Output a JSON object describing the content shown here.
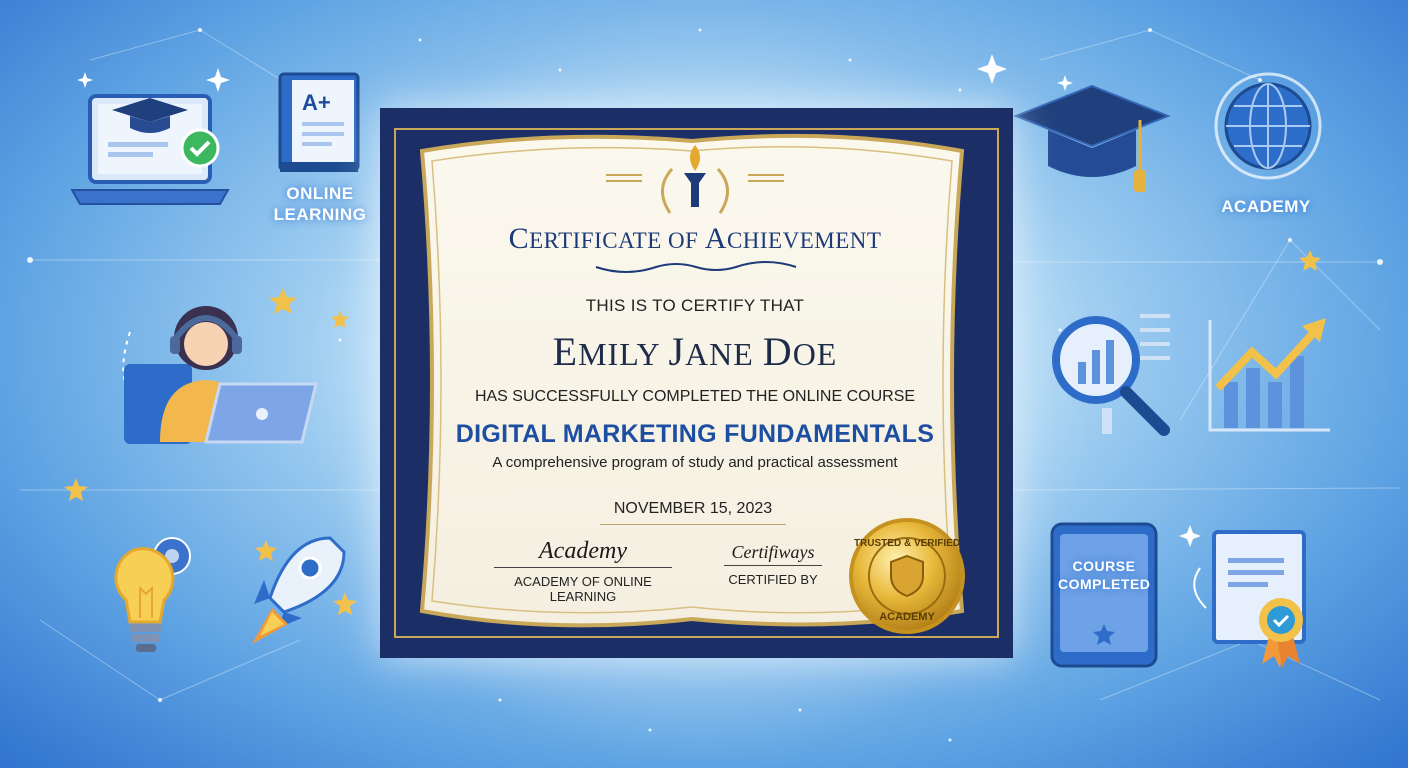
{
  "left_panel": {
    "online_learning_label": "ONLINE\nLEARNING",
    "book_grade": "A+"
  },
  "right_panel": {
    "academy_label": "ACADEMY",
    "tablet_label": "COURSE\nCOMPLETED"
  },
  "certificate": {
    "title_big_c": "C",
    "title_part1": "ERTIFICATE ",
    "title_of": "OF",
    "title_big_a": " A",
    "title_part2": "CHIEVEMENT",
    "certify_line": "THIS IS TO CERTIFY THAT",
    "recipient_e": "E",
    "recipient_rest1": "MILY ",
    "recipient_j": "J",
    "recipient_rest2": "ANE ",
    "recipient_d": "D",
    "recipient_rest3": "OE",
    "completed_line": "HAS SUCCESSFULLY COMPLETED THE ONLINE COURSE",
    "course_name": "DIGITAL MARKETING FUNDAMENTALS",
    "description": "A comprehensive program of study and practical assessment",
    "date": "NOVEMBER 15, 2023",
    "signature1_script": "Academy",
    "signature1_label": "ACADEMY OF ONLINE LEARNING",
    "signature2_script": "Certifiways",
    "signature2_label": "CERTIFIED BY",
    "seal_text_top": "TRUSTED & VERIFIED",
    "seal_text_bottom": "ACADEMY"
  },
  "colors": {
    "navy": "#1b2f66",
    "gold": "#c9a85a",
    "course_blue": "#1d4ea1"
  }
}
